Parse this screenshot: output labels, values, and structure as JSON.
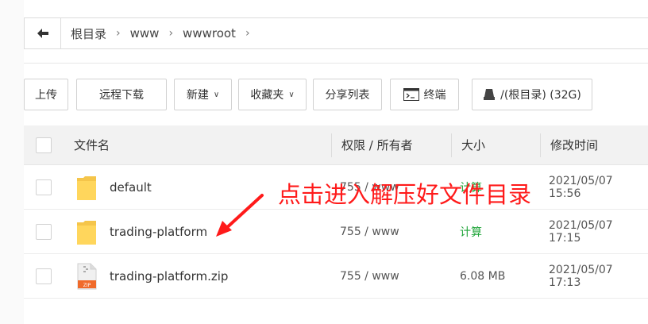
{
  "breadcrumb": {
    "items": [
      "根目录",
      "www",
      "wwwroot"
    ]
  },
  "toolbar": {
    "upload": "上传",
    "remote_download": "远程下载",
    "new": "新建",
    "favorites": "收藏夹",
    "share_list": "分享列表",
    "terminal": "终端",
    "disk": "/(根目录) (32G)"
  },
  "table": {
    "headers": {
      "name": "文件名",
      "perm": "权限 / 所有者",
      "size": "大小",
      "mtime": "修改时间"
    },
    "rows": [
      {
        "name": "default",
        "perm": "755 / www",
        "size": "计算",
        "mtime": "2021/05/07 15:56",
        "icon": "folder-icon"
      },
      {
        "name": "trading-platform",
        "perm": "755 / www",
        "size": "计算",
        "mtime": "2021/05/07 17:15",
        "icon": "folder-icon"
      },
      {
        "name": "trading-platform.zip",
        "perm": "755 / www",
        "size": "6.08 MB",
        "mtime": "2021/05/07 17:13",
        "icon": "zip-file-icon"
      }
    ]
  },
  "annotation": {
    "text": "点击进入解压好文件目录",
    "color": "#ff1a1a"
  },
  "colors": {
    "accent_green": "#20a53a",
    "header_bg": "#f2f2f2"
  }
}
